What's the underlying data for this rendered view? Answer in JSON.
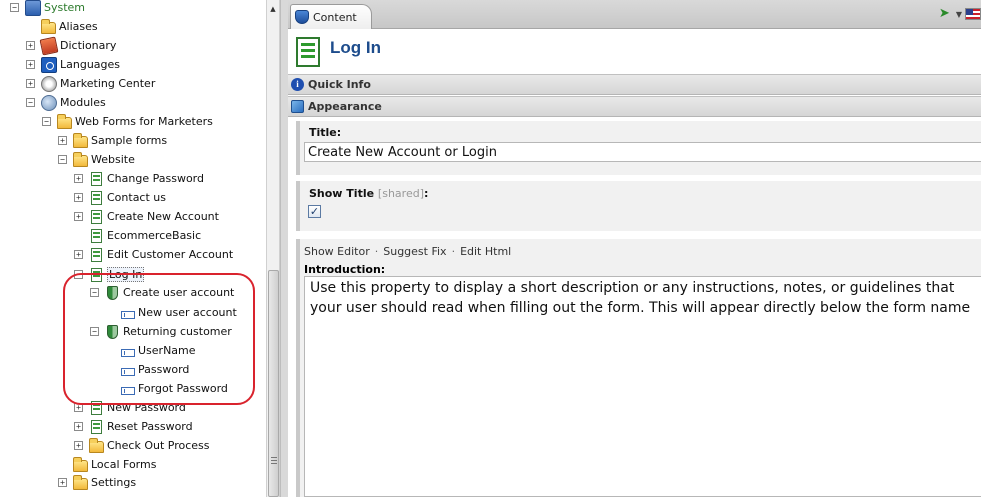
{
  "tree": {
    "items": [
      {
        "label": "System",
        "icon": "system-icon",
        "expander": "minus"
      },
      {
        "label": "Aliases",
        "icon": "folder-icon",
        "expander": "none"
      },
      {
        "label": "Dictionary",
        "icon": "dictionary-icon",
        "expander": "plus"
      },
      {
        "label": "Languages",
        "icon": "languages-icon",
        "expander": "plus"
      },
      {
        "label": "Marketing Center",
        "icon": "marketing-icon",
        "expander": "plus"
      },
      {
        "label": "Modules",
        "icon": "modules-icon",
        "expander": "minus"
      },
      {
        "label": "Web Forms for Marketers",
        "icon": "folder-icon",
        "expander": "minus"
      },
      {
        "label": "Sample forms",
        "icon": "folder-icon",
        "expander": "plus"
      },
      {
        "label": "Website",
        "icon": "folder-icon",
        "expander": "minus"
      },
      {
        "label": "Change Password",
        "icon": "form-icon",
        "expander": "plus"
      },
      {
        "label": "Contact us",
        "icon": "form-icon",
        "expander": "plus"
      },
      {
        "label": "Create New Account",
        "icon": "form-icon",
        "expander": "plus"
      },
      {
        "label": "EcommerceBasic",
        "icon": "form-icon",
        "expander": "none"
      },
      {
        "label": "Edit Customer Account",
        "icon": "form-icon",
        "expander": "plus"
      },
      {
        "label": "Log In",
        "icon": "form-icon",
        "expander": "minus",
        "selected": true
      },
      {
        "label": "Create user account",
        "icon": "section-icon",
        "expander": "minus"
      },
      {
        "label": "New user account",
        "icon": "field-icon",
        "expander": "none"
      },
      {
        "label": "Returning customer",
        "icon": "section-icon",
        "expander": "minus"
      },
      {
        "label": "UserName",
        "icon": "field-icon",
        "expander": "none"
      },
      {
        "label": "Password",
        "icon": "field-icon",
        "expander": "none"
      },
      {
        "label": "Forgot Password",
        "icon": "field-icon",
        "expander": "none"
      },
      {
        "label": "New Password",
        "icon": "form-icon",
        "expander": "plus"
      },
      {
        "label": "Reset Password",
        "icon": "form-icon",
        "expander": "plus"
      },
      {
        "label": "Check Out Process",
        "icon": "folder-icon",
        "expander": "plus"
      },
      {
        "label": "Local Forms",
        "icon": "folder-icon",
        "expander": "none"
      },
      {
        "label": "Settings",
        "icon": "folder-icon",
        "expander": "plus"
      }
    ],
    "highlight_color": "#d9232d"
  },
  "tab": {
    "label": "Content"
  },
  "item": {
    "title": "Log In"
  },
  "sections": {
    "quick_info": "Quick Info",
    "appearance": "Appearance"
  },
  "fields": {
    "title_label": "Title:",
    "title_value": "Create New Account or Login",
    "show_title_label": "Show Title",
    "show_title_shared": "[shared]",
    "show_title_colon": ":",
    "show_title_checked": true,
    "checkbox_glyph": "✓",
    "editor_links": [
      "Show Editor",
      "Suggest Fix",
      "Edit Html"
    ],
    "link_separator": "·",
    "intro_label": "Introduction:",
    "intro_lines": [
      "Use this property to display a short description or any instructions, notes, or guidelines that",
      "your user should read when filling out the form. This will appear directly below the form name"
    ]
  },
  "colors": {
    "selected_text": "#2b7a2b",
    "title_text": "#1d4c8c"
  }
}
